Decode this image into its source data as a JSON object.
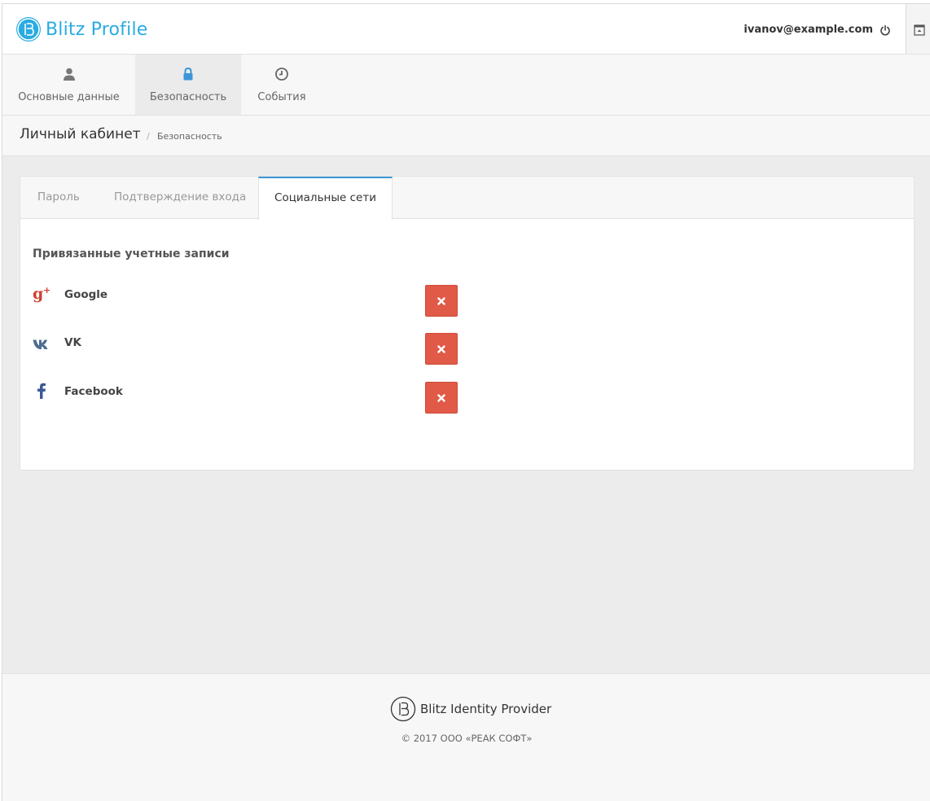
{
  "app": {
    "logo_letter": "B",
    "title": "Blitz Profile",
    "brand_color": "#29abe2"
  },
  "header": {
    "user_email": "ivanov@example.com",
    "logout_icon": "power-icon",
    "side_toggle_icon": "panel-toggle-icon"
  },
  "nav": {
    "items": [
      {
        "label": "Основные данные",
        "icon": "user-icon",
        "active": false
      },
      {
        "label": "Безопасность",
        "icon": "lock-icon",
        "active": true
      },
      {
        "label": "События",
        "icon": "clock-icon",
        "active": false
      }
    ]
  },
  "breadcrumb": {
    "title": "Личный кабинет",
    "separator": "/",
    "current": "Безопасность"
  },
  "tabs": [
    {
      "label": "Пароль",
      "active": false
    },
    {
      "label": "Подтверждение входа",
      "active": false
    },
    {
      "label": "Социальные сети",
      "active": true
    }
  ],
  "linked_accounts": {
    "title": "Привязанные учетные записи",
    "accounts": [
      {
        "name": "Google",
        "icon": "google-plus-icon"
      },
      {
        "name": "VK",
        "icon": "vk-icon"
      },
      {
        "name": "Facebook",
        "icon": "facebook-icon"
      }
    ],
    "remove_icon": "close-icon",
    "remove_color": "#e05a47"
  },
  "footer": {
    "brand": "Blitz Identity Provider",
    "copyright": "© 2017 ООО «РЕАК СОФТ»"
  }
}
